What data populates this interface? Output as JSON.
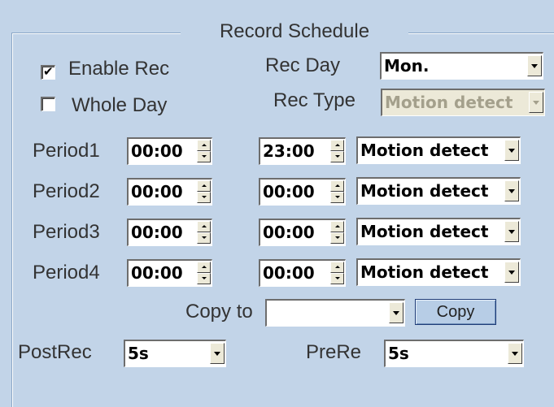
{
  "section_title": "Record Schedule",
  "enable_rec": {
    "label": "Enable Rec",
    "checked": true
  },
  "whole_day": {
    "label": "Whole Day",
    "checked": false
  },
  "rec_day": {
    "label": "Rec Day",
    "value": "Mon."
  },
  "rec_type": {
    "label": "Rec Type",
    "value": "Motion detect",
    "disabled": true
  },
  "periods": [
    {
      "label": "Period1",
      "start": "00:00",
      "end": "23:00",
      "type": "Motion detect"
    },
    {
      "label": "Period2",
      "start": "00:00",
      "end": "00:00",
      "type": "Motion detect"
    },
    {
      "label": "Period3",
      "start": "00:00",
      "end": "00:00",
      "type": "Motion detect"
    },
    {
      "label": "Period4",
      "start": "00:00",
      "end": "00:00",
      "type": "Motion detect"
    }
  ],
  "copy_to": {
    "label": "Copy to",
    "value": "",
    "button_label": "Copy"
  },
  "post_rec": {
    "label": "PostRec",
    "value": "5s"
  },
  "pre_rec": {
    "label": "PreRe",
    "value": "5s"
  },
  "colors": {
    "background": "#c2d4e8",
    "button_border": "#1e3c78"
  }
}
